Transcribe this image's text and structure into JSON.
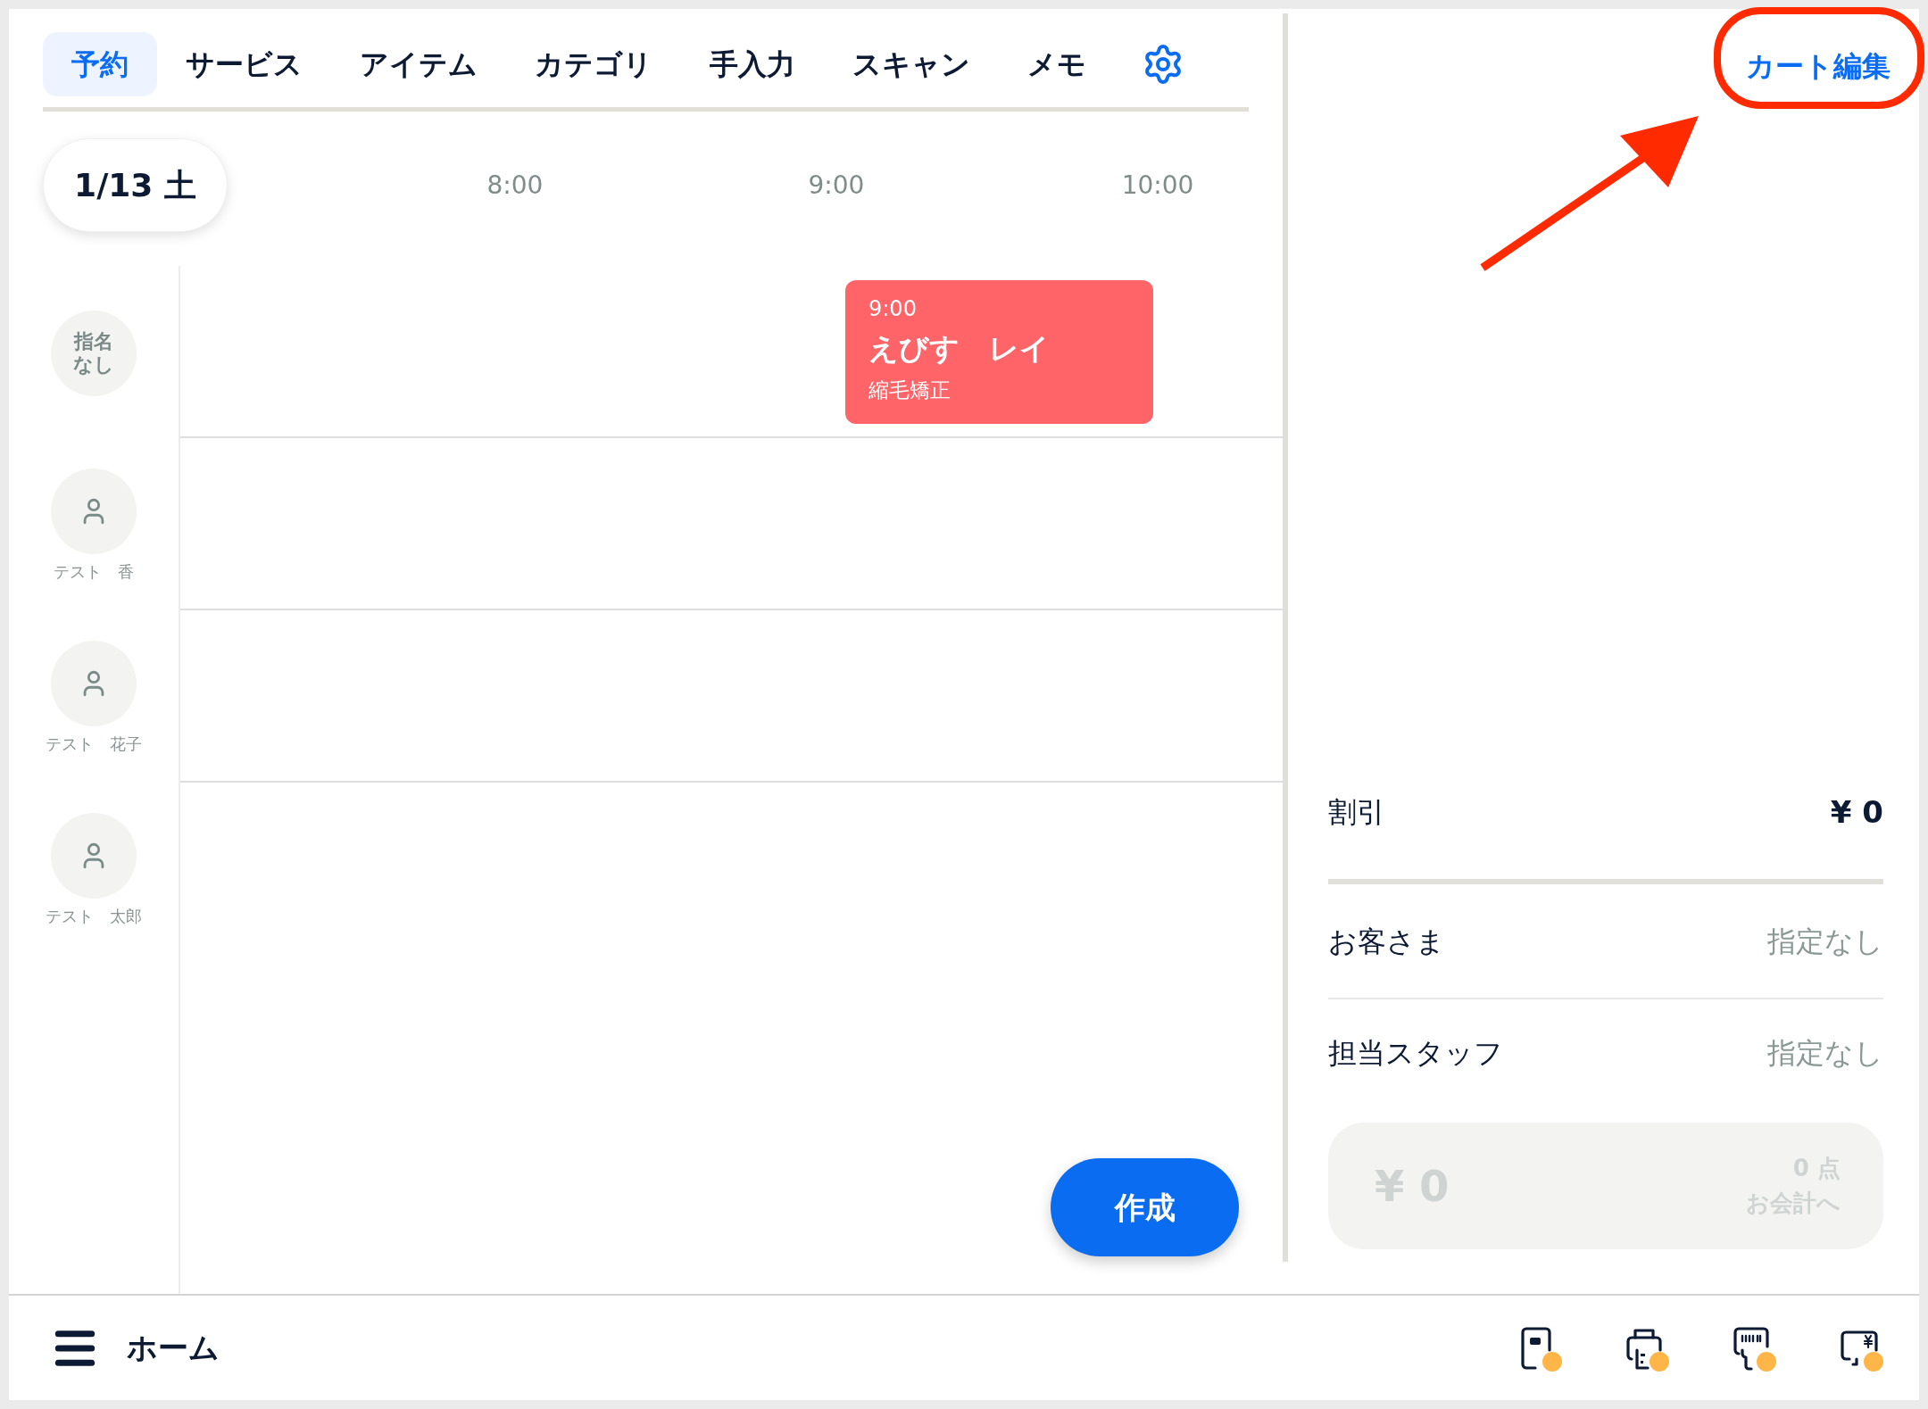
{
  "tabs": [
    {
      "label": "予約",
      "selected": true
    },
    {
      "label": "サービス",
      "selected": false
    },
    {
      "label": "アイテム",
      "selected": false
    },
    {
      "label": "カテゴリ",
      "selected": false
    },
    {
      "label": "手入力",
      "selected": false
    },
    {
      "label": "スキャン",
      "selected": false
    },
    {
      "label": "メモ",
      "selected": false
    }
  ],
  "date": "1/13 土",
  "time_labels": [
    "8:00",
    "9:00",
    "10:00"
  ],
  "staff": [
    {
      "kind": "unassigned",
      "label": "指名なし",
      "appointments": [
        {
          "time": "9:00",
          "customer": "えびす　レイ",
          "service": "縮毛矯正",
          "color": "#ff6468"
        }
      ]
    },
    {
      "kind": "person",
      "label": "テスト　香"
    },
    {
      "kind": "person",
      "label": "テスト　花子"
    },
    {
      "kind": "person",
      "label": "テスト　太郎"
    }
  ],
  "create_button": "作成",
  "cart_edit": "カート編集",
  "discount": {
    "label": "割引",
    "value": "¥ 0"
  },
  "details": [
    {
      "label": "お客さま",
      "value": "指定なし"
    },
    {
      "label": "担当スタッフ",
      "value": "指定なし"
    }
  ],
  "checkout": {
    "total": "¥ 0",
    "count": "0 点",
    "action": "お会計へ",
    "disabled": true
  },
  "bottom_bar": {
    "title": "ホーム",
    "devices": [
      {
        "kind": "reader",
        "color": "#ffb547"
      },
      {
        "kind": "printer",
        "color": "#ffb547"
      },
      {
        "kind": "scanner",
        "color": "#ffb547"
      },
      {
        "kind": "display",
        "color": "#ffb547"
      }
    ]
  }
}
